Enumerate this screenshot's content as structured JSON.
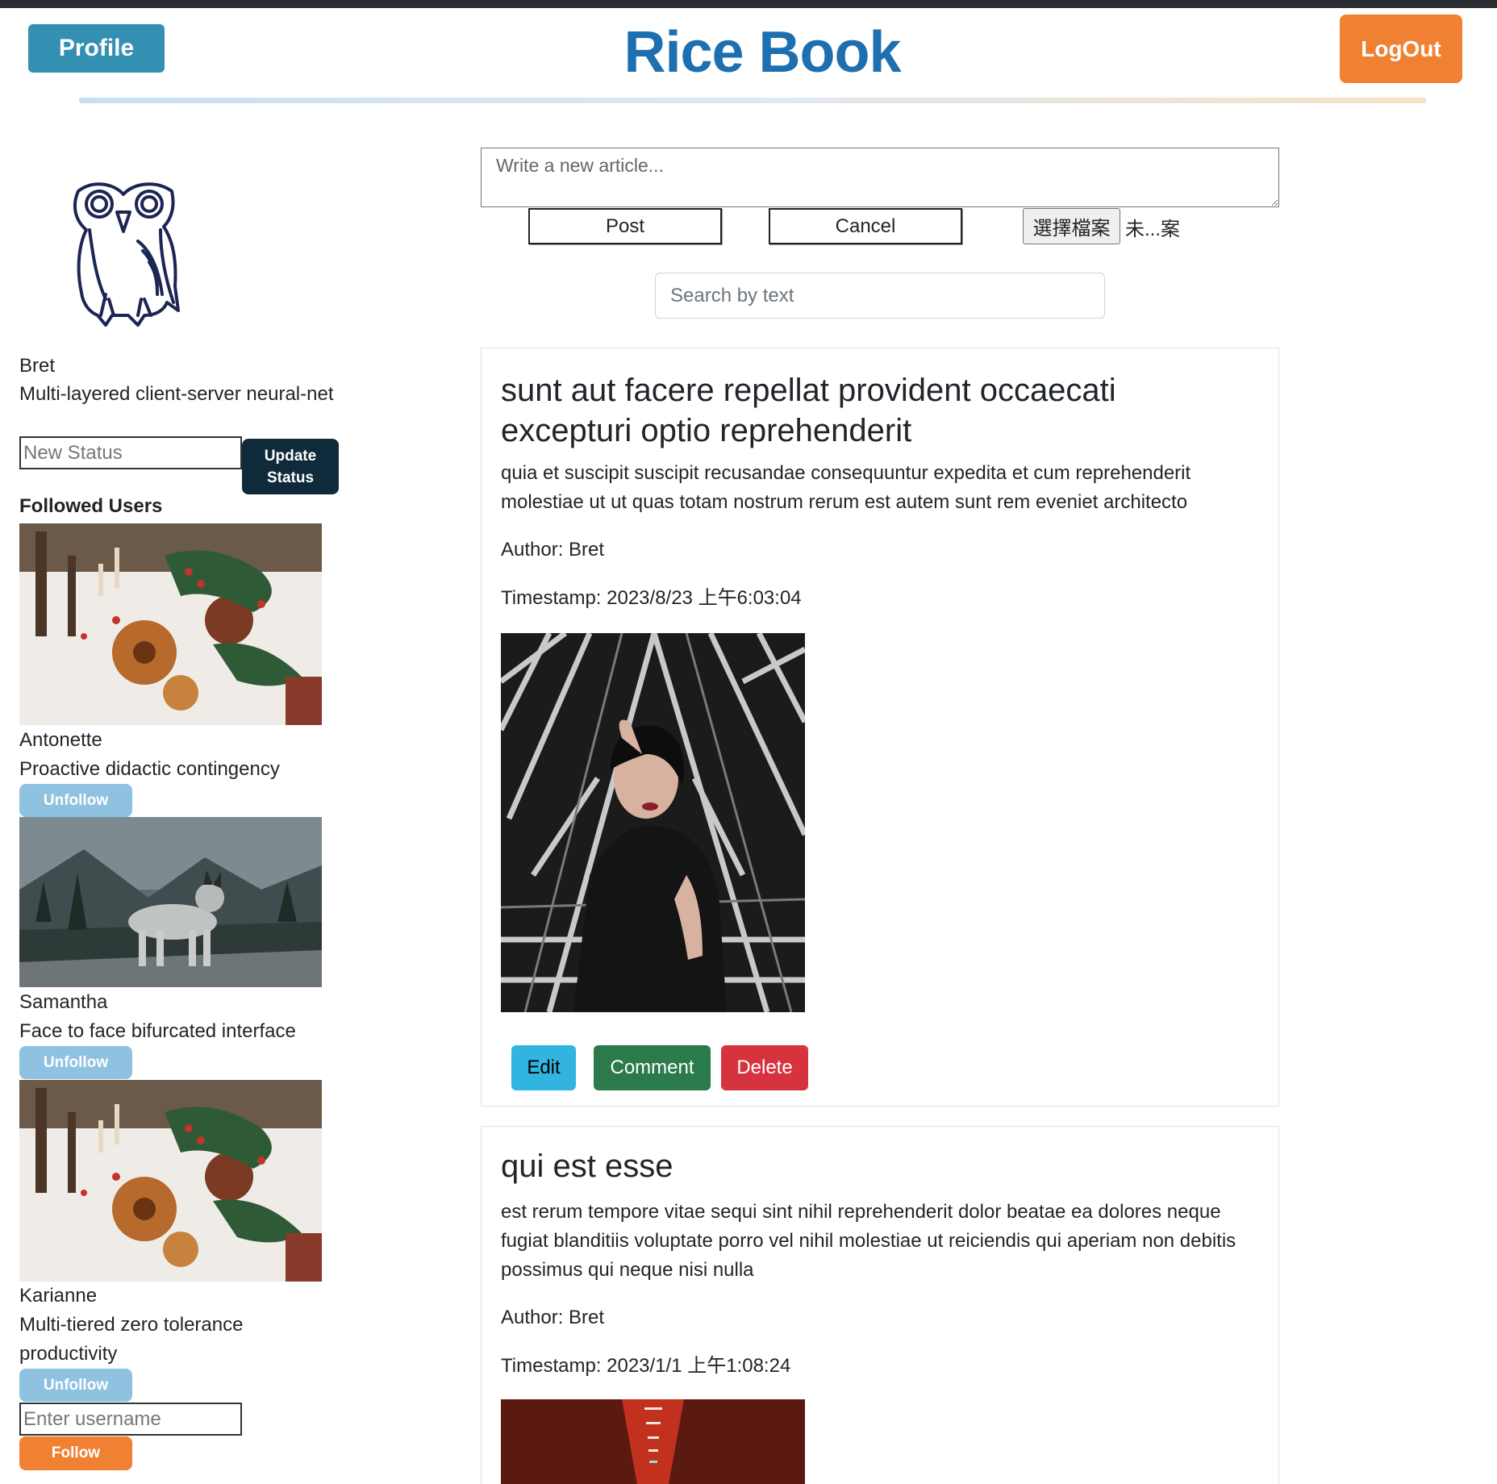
{
  "header": {
    "profile_label": "Profile",
    "title": "Rice Book",
    "logout_label": "LogOut"
  },
  "user": {
    "name": "Bret",
    "status": "Multi-layered client-server neural-net",
    "new_status_placeholder": "New Status",
    "update_status_label": "Update Status"
  },
  "followed": {
    "title": "Followed Users",
    "users": [
      {
        "name": "Antonette",
        "status": "Proactive didactic contingency",
        "unfollow_label": "Unfollow"
      },
      {
        "name": "Samantha",
        "status": "Face to face bifurcated interface",
        "unfollow_label": "Unfollow"
      },
      {
        "name": "Karianne",
        "status": "Multi-tiered zero tolerance productivity",
        "unfollow_label": "Unfollow"
      }
    ],
    "username_placeholder": "Enter username",
    "follow_label": "Follow"
  },
  "composer": {
    "placeholder": "Write a new article...",
    "post_label": "Post",
    "cancel_label": "Cancel",
    "choose_file_label": "選擇檔案",
    "file_status": "未...案"
  },
  "search": {
    "placeholder": "Search by text"
  },
  "articles": [
    {
      "title": "sunt aut facere repellat provident occaecati excepturi optio reprehenderit",
      "body": "quia et suscipit suscipit recusandae consequuntur expedita et cum reprehenderit molestiae ut ut quas totam nostrum rerum est autem sunt rem eveniet architecto",
      "author": "Author: Bret",
      "timestamp": "Timestamp: 2023/8/23 上午6:03:04",
      "edit_label": "Edit",
      "comment_label": "Comment",
      "delete_label": "Delete"
    },
    {
      "title": "qui est esse",
      "body": "est rerum tempore vitae sequi sint nihil reprehenderit dolor beatae ea dolores neque fugiat blanditiis voluptate porro vel nihil molestiae ut reiciendis qui aperiam non debitis possimus qui neque nisi nulla",
      "author": "Author: Bret",
      "timestamp": "Timestamp: 2023/1/1 上午1:08:24"
    }
  ],
  "colors": {
    "title_blue": "#1e6fb0",
    "profile_teal": "#3490b3",
    "logout_orange": "#f08132",
    "unfollow_lightblue": "#8fc1e1",
    "update_navy": "#0f2b3b",
    "edit_cyan": "#31b5e0",
    "comment_green": "#2b7a4b",
    "delete_red": "#d6333f"
  },
  "icons": {
    "logo": "owl-icon"
  }
}
